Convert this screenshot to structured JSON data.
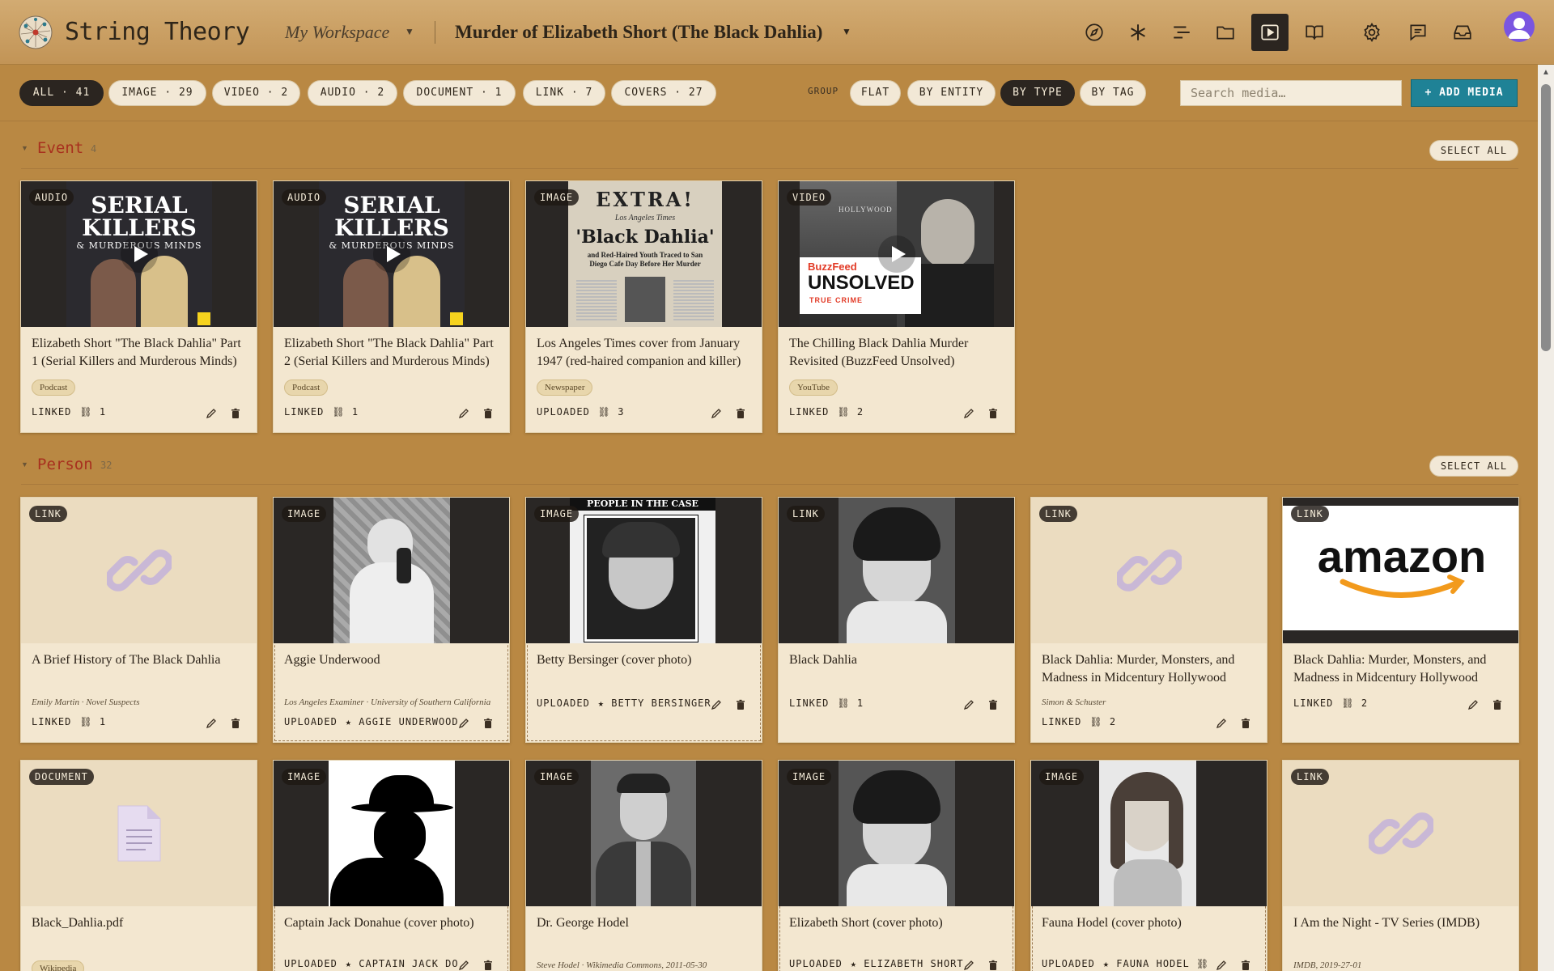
{
  "header": {
    "app_title": "String Theory",
    "workspace": "My Workspace",
    "case_title": "Murder of Elizabeth Short (The Black Dahlia)",
    "icons": [
      "compass-icon",
      "asterisk-icon",
      "timeline-icon",
      "folder-icon",
      "media-icon",
      "book-icon",
      "gear-icon",
      "chat-icon",
      "inbox-icon"
    ]
  },
  "filters": {
    "types": [
      {
        "label": "ALL · 41",
        "active": true
      },
      {
        "label": "IMAGE · 29"
      },
      {
        "label": "VIDEO · 2"
      },
      {
        "label": "AUDIO · 2"
      },
      {
        "label": "DOCUMENT · 1"
      },
      {
        "label": "LINK · 7"
      },
      {
        "label": "COVERS · 27"
      }
    ],
    "group_label": "GROUP",
    "groups": [
      {
        "label": "FLAT"
      },
      {
        "label": "BY ENTITY"
      },
      {
        "label": "BY TYPE",
        "active": true
      },
      {
        "label": "BY TAG"
      }
    ],
    "search_placeholder": "Search media…",
    "add_label": "+ ADD MEDIA"
  },
  "sections": [
    {
      "title": "Event",
      "count": "4",
      "select_all": "SELECT ALL",
      "cards": [
        {
          "badge": "AUDIO",
          "title": "Elizabeth Short \"The Black Dahlia\" Part 1 (Serial Killers and Murderous Minds)",
          "tag": "Podcast",
          "status": "LINKED",
          "links": "⛓ 1",
          "thumb": "podcast"
        },
        {
          "badge": "AUDIO",
          "title": "Elizabeth Short \"The Black Dahlia\" Part 2 (Serial Killers and Murderous Minds)",
          "tag": "Podcast",
          "status": "LINKED",
          "links": "⛓ 1",
          "thumb": "podcast"
        },
        {
          "badge": "IMAGE",
          "title": "Los Angeles Times cover from January 1947 (red-haired companion and killer)",
          "tag": "Newspaper",
          "status": "UPLOADED",
          "links": "⛓ 3",
          "thumb": "newspaper"
        },
        {
          "badge": "VIDEO",
          "title": "The Chilling Black Dahlia Murder Revisited (BuzzFeed Unsolved)",
          "tag": "YouTube",
          "status": "LINKED",
          "links": "⛓ 2",
          "thumb": "buzzfeed"
        }
      ],
      "podcast_text": {
        "line1": "SERIAL",
        "line2": "KILLERS",
        "line3": "& MURDEROUS MINDS"
      },
      "newspaper_text": {
        "extra": "EXTRA!",
        "paper": "Los Angeles Times",
        "headline": "'Black Dahlia'",
        "sub": "and Red-Haired Youth Traced to San Diego Cafe Day Before Her Murder"
      },
      "buzzfeed_text": {
        "brand": "BuzzFeed",
        "show": "UNSOLVED",
        "genre": "TRUE CRIME",
        "sign": "HOLLYWOOD"
      }
    },
    {
      "title": "Person",
      "count": "32",
      "select_all": "SELECT ALL",
      "cards": [
        {
          "badge": "LINK",
          "title": "A Brief History of The Black Dahlia",
          "meta": "Emily Martin · Novel Suspects",
          "status": "LINKED",
          "links": "⛓ 1"
        },
        {
          "badge": "IMAGE",
          "title": "Aggie Underwood",
          "meta": "Los Angeles Examiner · University of Southern California",
          "status": "UPLOADED",
          "links": "★ AGGIE UNDERWOOD"
        },
        {
          "badge": "IMAGE",
          "title": "Betty Bersinger (cover photo)",
          "status": "UPLOADED",
          "links": "★ BETTY BERSINGER",
          "caption": "PEOPLE IN THE CASE"
        },
        {
          "badge": "LINK",
          "title": "Black Dahlia",
          "status": "LINKED",
          "links": "⛓ 1"
        },
        {
          "badge": "LINK",
          "title": "Black Dahlia: Murder, Monsters, and Madness in Midcentury Hollywood",
          "meta": "Simon & Schuster",
          "status": "LINKED",
          "links": "⛓ 2"
        },
        {
          "badge": "LINK",
          "title": "Black Dahlia: Murder, Monsters, and Madness in Midcentury Hollywood",
          "status": "LINKED",
          "links": "⛓ 2",
          "logo": "amazon"
        }
      ]
    },
    {
      "cards": [
        {
          "badge": "DOCUMENT",
          "title": "Black_Dahlia.pdf",
          "tag": "Wikipedia"
        },
        {
          "badge": "IMAGE",
          "title": "Captain Jack Donahue (cover photo)",
          "status": "UPLOADED",
          "links": "★ CAPTAIN JACK DONAHUE"
        },
        {
          "badge": "IMAGE",
          "title": "Dr. George Hodel",
          "meta": "Steve Hodel · Wikimedia Commons, 2011-05-30"
        },
        {
          "badge": "IMAGE",
          "title": "Elizabeth Short (cover photo)",
          "status": "UPLOADED",
          "links": "★ ELIZABETH SHORT"
        },
        {
          "badge": "IMAGE",
          "title": "Fauna Hodel (cover photo)",
          "status": "UPLOADED",
          "links": "★ FAUNA HODEL ⛓"
        },
        {
          "badge": "LINK",
          "title": "I Am the Night - TV Series (IMDB)",
          "meta": "IMDB, 2019-27-01"
        }
      ]
    }
  ],
  "colors": {
    "background": "#b98843",
    "accent": "#1f8296",
    "section_title": "#a8301e",
    "card": "#f3e7d0",
    "dark": "#2b2520"
  }
}
